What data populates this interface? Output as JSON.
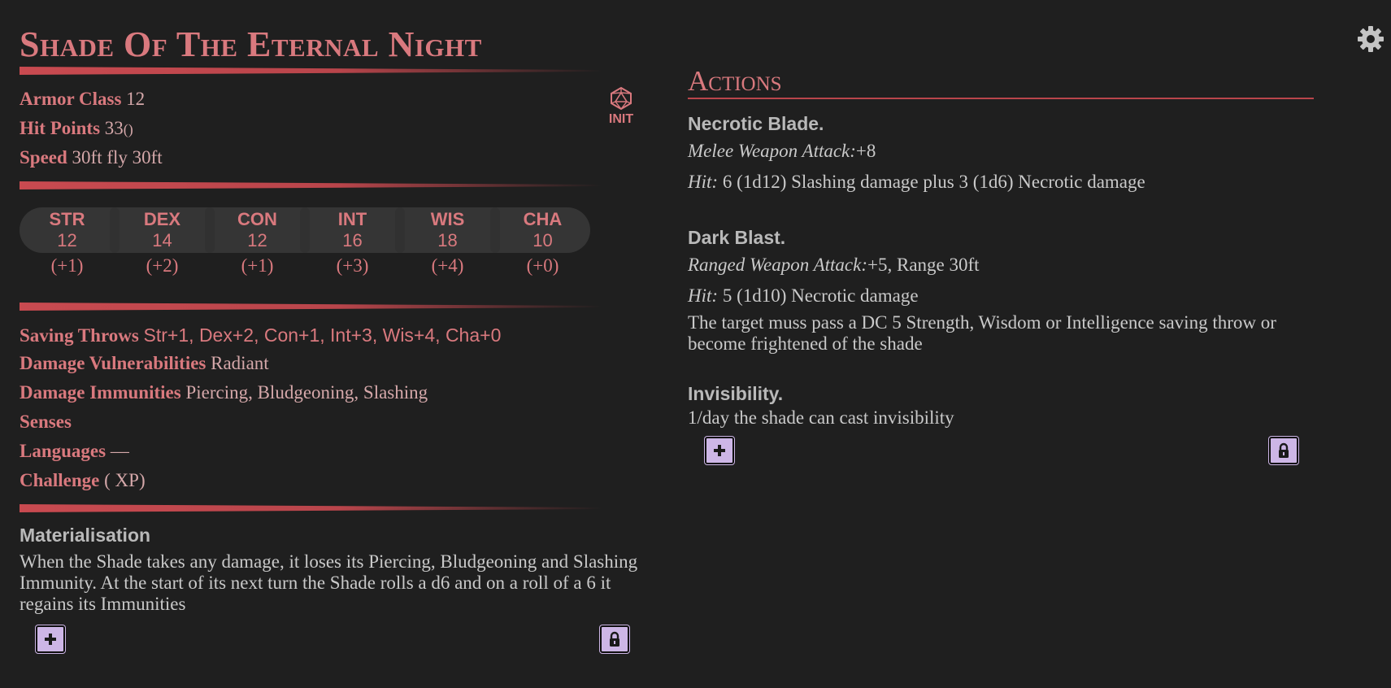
{
  "monster": {
    "name": "Shade Of The Eternal Night",
    "armor_class_label": "Armor Class",
    "armor_class": "12",
    "hit_points_label": "Hit Points",
    "hit_points": "33",
    "hit_points_formula": "()",
    "speed_label": "Speed",
    "speed": "30ft fly 30ft",
    "init_label": "INIT"
  },
  "abilities": [
    {
      "name": "STR",
      "score": "12",
      "mod": "(+1)"
    },
    {
      "name": "DEX",
      "score": "14",
      "mod": "(+2)"
    },
    {
      "name": "CON",
      "score": "12",
      "mod": "(+1)"
    },
    {
      "name": "INT",
      "score": "16",
      "mod": "(+3)"
    },
    {
      "name": "WIS",
      "score": "18",
      "mod": "(+4)"
    },
    {
      "name": "CHA",
      "score": "10",
      "mod": "(+0)"
    }
  ],
  "details": {
    "saving_throws_label": "Saving Throws",
    "saving_throws": "Str+1, Dex+2, Con+1, Int+3, Wis+4, Cha+0",
    "vulnerabilities_label": "Damage Vulnerabilities",
    "vulnerabilities": "Radiant",
    "immunities_label": "Damage Immunities",
    "immunities": "Piercing, Bludgeoning, Slashing",
    "senses_label": "Senses",
    "languages_label": "Languages",
    "languages": "—",
    "challenge_label": "Challenge",
    "challenge": "( XP)"
  },
  "traits": [
    {
      "name": "Materialisation",
      "text": "When the Shade takes any damage, it loses its Piercing, Bludgeoning and Slashing Immunity. At the start of its next turn the Shade rolls a d6 and on a roll of a 6 it regains its Immunities"
    }
  ],
  "actions_heading": "Actions",
  "actions": [
    {
      "name": "Necrotic Blade.",
      "attack_type": "Melee Weapon Attack:",
      "attack_bonus": "+8",
      "hit_label": "Hit:",
      "hit": "6 (1d12) Slashing damage plus 3 (1d6) Necrotic damage"
    },
    {
      "name": "Dark Blast.",
      "attack_type": "Ranged Weapon Attack:",
      "attack_bonus": "+5, Range 30ft",
      "hit_label": "Hit:",
      "hit": "5 (1d10) Necrotic damage",
      "description": "The target muss pass a DC 5 Strength, Wisdom or Intelligence saving throw or become frightened of the shade"
    },
    {
      "name": "Invisibility.",
      "description": "1/day the shade can cast invisibility"
    }
  ],
  "icons": {
    "add": "plus-icon",
    "lock": "lock-icon",
    "settings": "gear-icon",
    "initiative": "d20-icon"
  },
  "colors": {
    "background": "#1f1f1f",
    "accent": "#d9797e",
    "button": "#cdb6e6"
  }
}
